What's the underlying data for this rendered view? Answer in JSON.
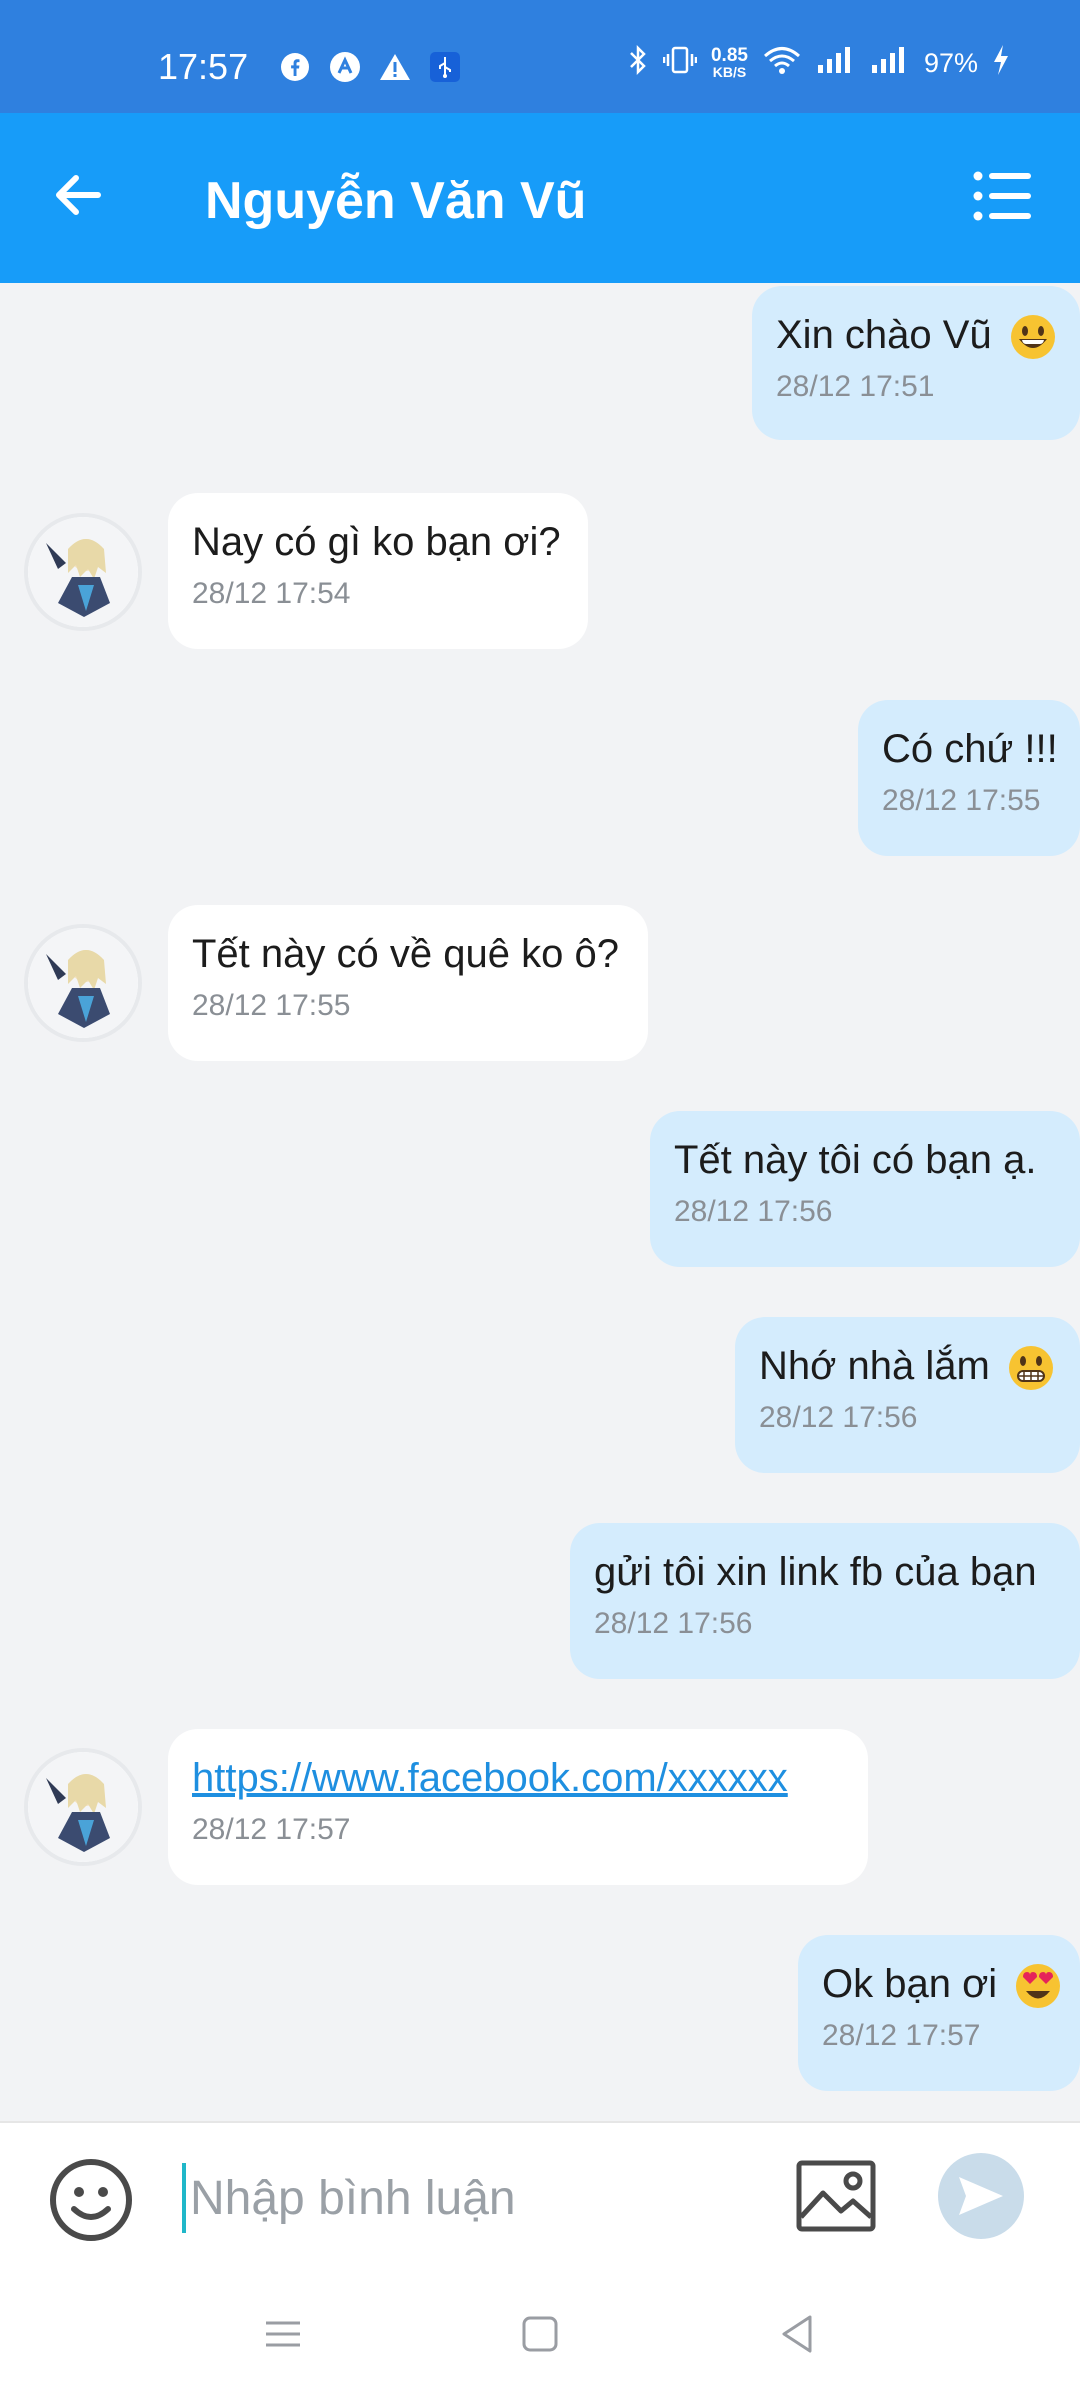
{
  "status_bar": {
    "time": "17:57",
    "net_speed_value": "0.85",
    "net_speed_unit": "KB/S",
    "battery": "97%"
  },
  "header": {
    "title": "Nguyễn Văn Vũ",
    "back_icon": "arrow-left-icon",
    "menu_icon": "list-menu-icon"
  },
  "messages": [
    {
      "direction": "out",
      "text": "Xin chào Vũ",
      "emoji": "grinning-face",
      "time": "28/12 17:51"
    },
    {
      "direction": "in",
      "text": "Nay có gì ko bạn ơi?",
      "time": "28/12 17:54"
    },
    {
      "direction": "out",
      "text": "Có chứ !!!",
      "time": "28/12 17:55"
    },
    {
      "direction": "in",
      "text": "Tết này có về quê ko ô?",
      "time": "28/12 17:55"
    },
    {
      "direction": "out",
      "text": "Tết này tôi có bạn ạ.",
      "time": "28/12 17:56"
    },
    {
      "direction": "out",
      "text": "Nhớ nhà lắm",
      "emoji": "grimacing-face",
      "time": "28/12 17:56"
    },
    {
      "direction": "out",
      "text": "gửi tôi xin link fb của bạn",
      "time": "28/12 17:56"
    },
    {
      "direction": "in",
      "text": "https://www.facebook.com/xxxxxx",
      "is_link": true,
      "time": "28/12 17:57"
    },
    {
      "direction": "out",
      "text": "Ok bạn ơi",
      "emoji": "heart-eyes-face",
      "time": "28/12 17:57"
    }
  ],
  "composer": {
    "placeholder": "Nhập bình luận",
    "value": ""
  },
  "colors": {
    "status_bar": "#2f80df",
    "app_bar": "#179cf9",
    "outgoing_bubble": "#d4ecfd",
    "incoming_bubble": "#ffffff",
    "background": "#f2f3f5",
    "link": "#1e8fe0"
  }
}
